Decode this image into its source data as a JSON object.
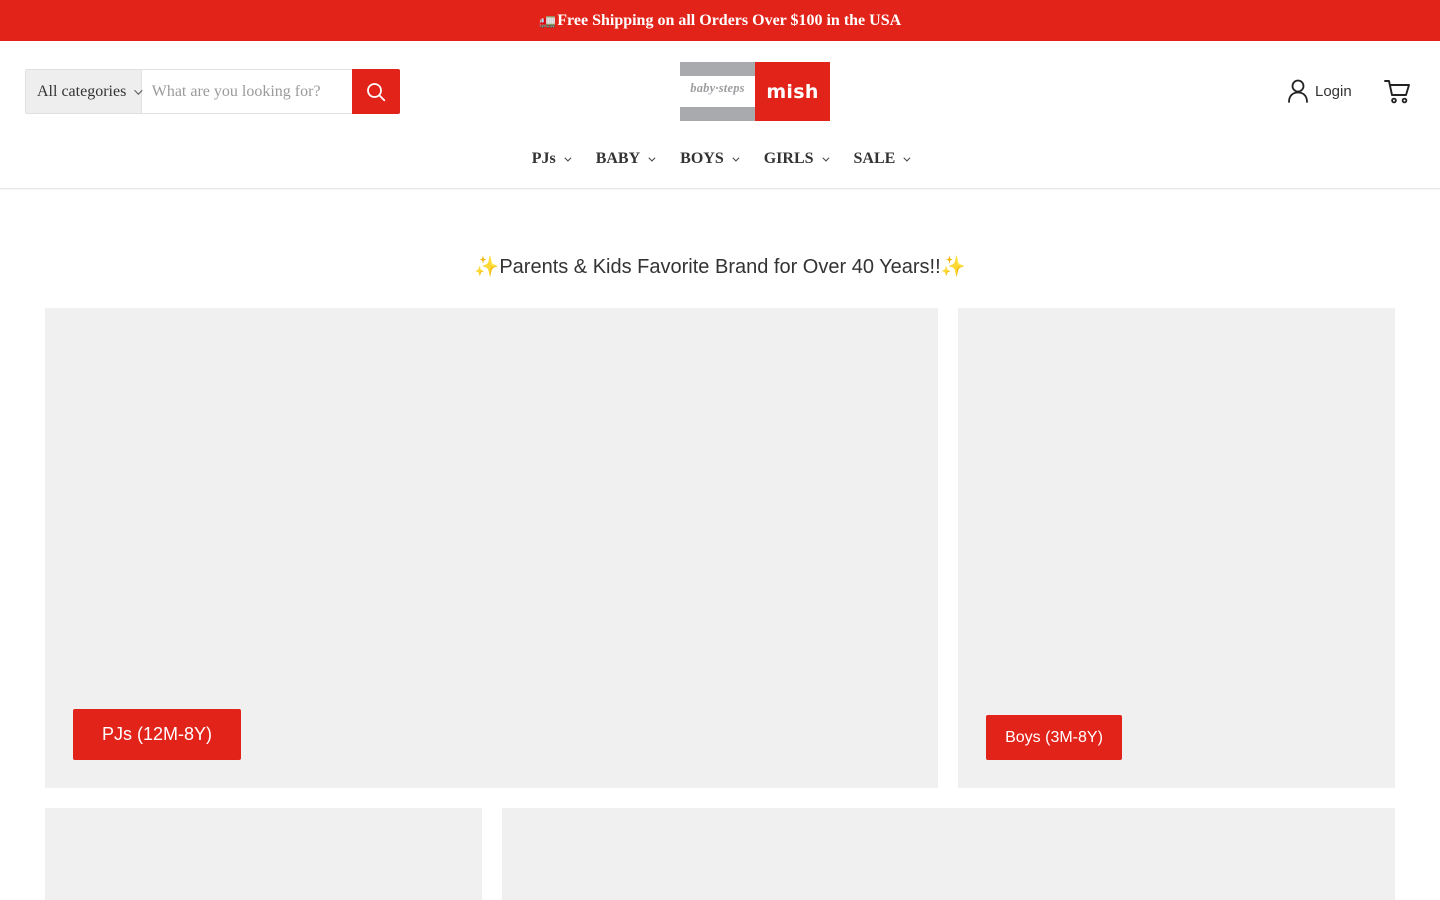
{
  "announcement": {
    "icon": "truck-icon",
    "glyph": "🚛",
    "text": "Free Shipping on all Orders Over $100 in the USA"
  },
  "search": {
    "category_label": "All categories",
    "placeholder": "What are you looking for?",
    "value": "",
    "submit_icon": "search-icon"
  },
  "logo": {
    "left_text": "baby·steps",
    "right_text": "mish"
  },
  "account": {
    "login_label": "Login",
    "login_icon": "user-icon",
    "cart_icon": "cart-icon"
  },
  "nav": {
    "items": [
      {
        "label": "PJs"
      },
      {
        "label": "BABY"
      },
      {
        "label": "BOYS"
      },
      {
        "label": "GIRLS"
      },
      {
        "label": "SALE"
      }
    ]
  },
  "tagline": {
    "spark_left": "✨",
    "text": "Parents & Kids Favorite Brand for Over 40 Years!!",
    "spark_right": "✨"
  },
  "tiles": [
    {
      "cta": "PJs (12M-8Y)"
    },
    {
      "cta": "Boys (3M-8Y)"
    },
    {
      "cta": ""
    },
    {
      "cta": ""
    }
  ],
  "colors": {
    "brand_red": "#e2231a",
    "tile_bg": "#f0f0f1",
    "logo_gray": "#a9aaad",
    "text": "#333333"
  }
}
